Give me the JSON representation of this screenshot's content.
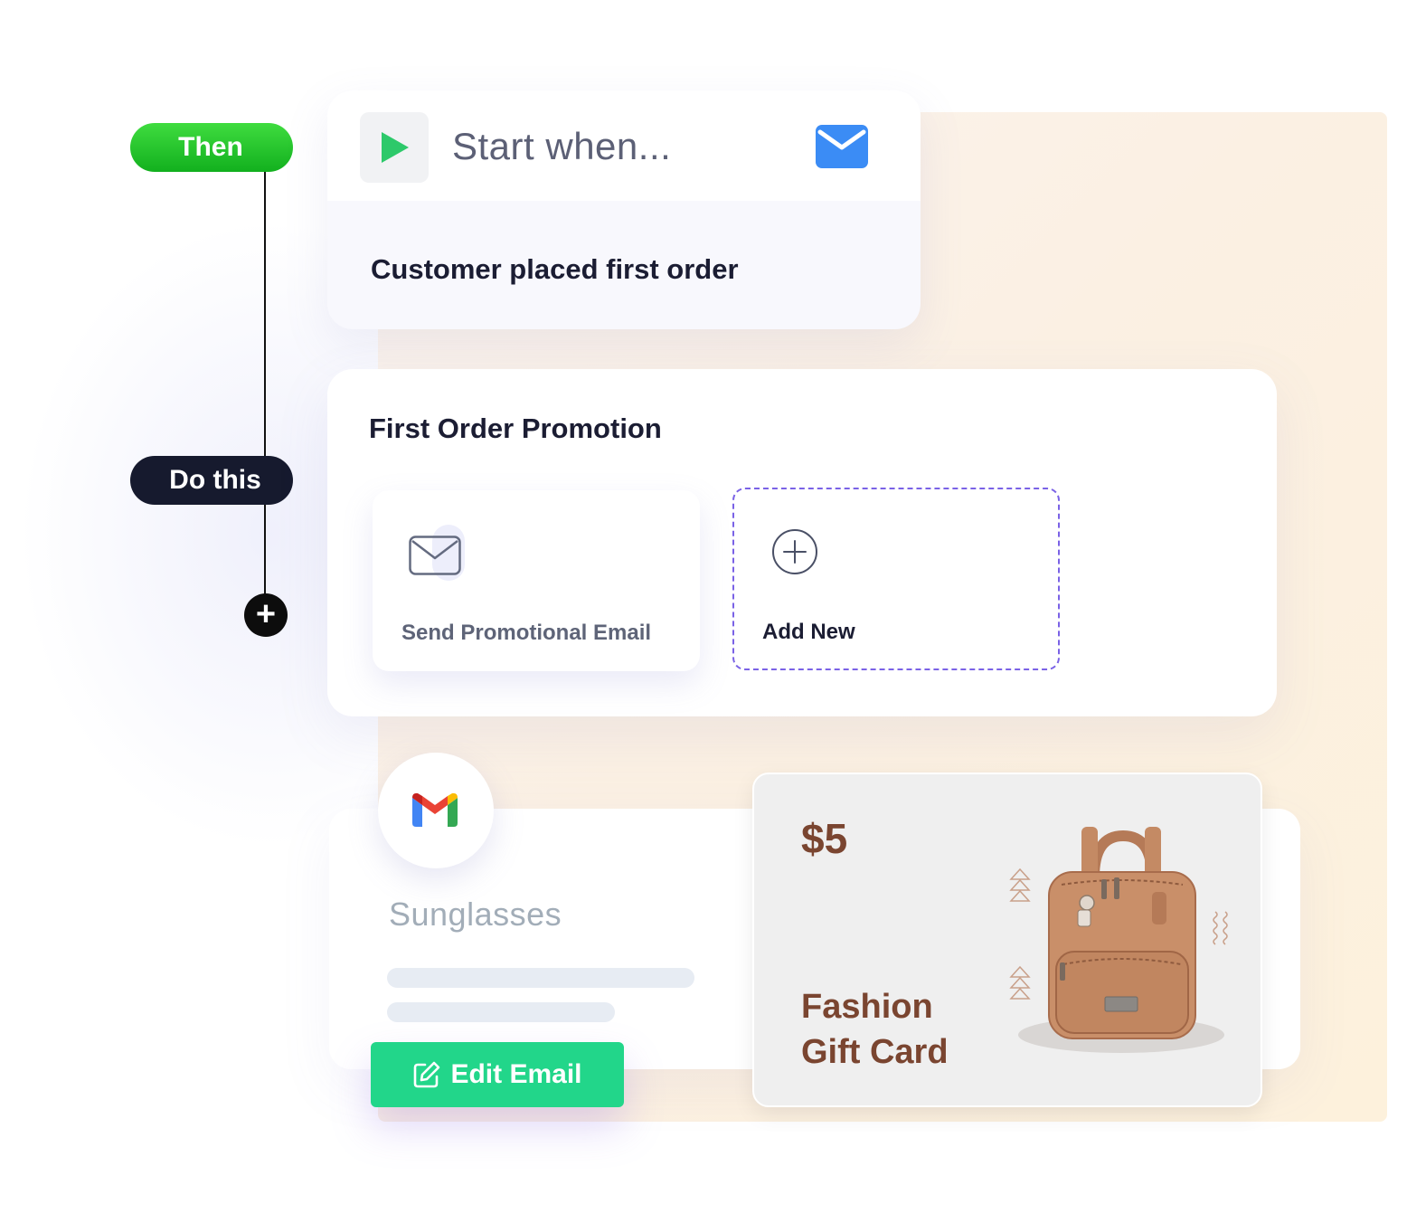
{
  "timeline": {
    "then_label": "Then",
    "do_label": "Do this",
    "add_step_label": "+"
  },
  "trigger": {
    "start_label": "Start when...",
    "condition": "Customer placed first order"
  },
  "promotion": {
    "title": "First Order Promotion",
    "actions": [
      {
        "label": "Send Promotional Email",
        "icon": "envelope-icon"
      }
    ],
    "add_new_label": "Add New"
  },
  "email_preview": {
    "provider_icon": "gmail-icon",
    "product_name": "Sunglasses",
    "edit_button_label": "Edit Email"
  },
  "gift_card": {
    "price": "$5",
    "title_line1": "Fashion",
    "title_line2": "Gift Card"
  },
  "colors": {
    "then_green": "#12b01e",
    "do_navy": "#161a2e",
    "edit_green": "#22d68a",
    "dashed_purple": "#7a62e6",
    "mail_blue": "#3b8cf5",
    "gift_brown": "#7a4530"
  }
}
